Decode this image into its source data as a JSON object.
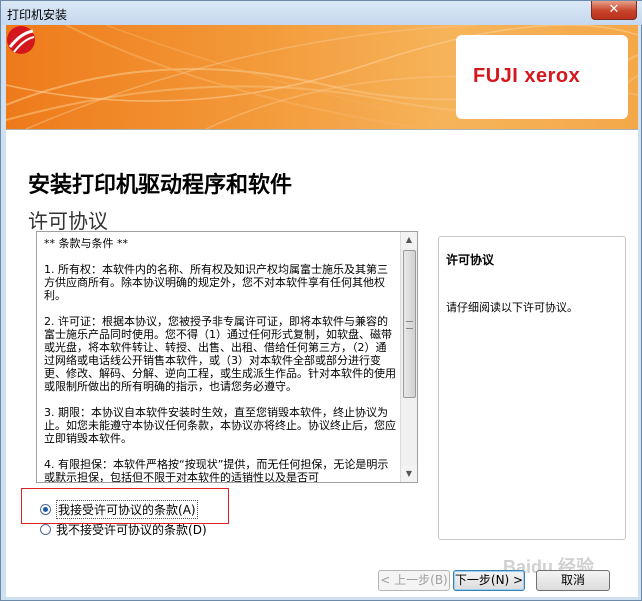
{
  "window": {
    "title": "打印机安装",
    "close_glyph": "✕"
  },
  "banner": {
    "logo_text": "FUJI xerox",
    "logo_color": "#d4161d",
    "accent": "#ee7a1a"
  },
  "heading": {
    "main": "安装打印机驱动程序和软件",
    "sub": "许可协议"
  },
  "license": {
    "text": "** 条款与条件 **\n\n1. 所有权：本软件内的名称、所有权及知识产权均属富士施乐及其第三方供应商所有。除本协议明确的规定外，您不对本软件享有任何其他权利。\n\n2. 许可证：根据本协议，您被授予非专属许可证，即将本软件与兼容的富士施乐产品同时使用。您不得（1）通过任何形式复制，如软盘、磁带或光盘，将本软件转让、转授、出售、出租、借给任何第三方，（2）通过网络或电话线公开销售本软件，或（3）对本软件全部或部分进行变更、修改、解码、分解、逆向工程，或生成派生作品。针对本软件的使用或限制所做出的所有明确的指示，也请您务必遵守。\n\n3. 期限：本协议自本软件安装时生效，直至您销毁本软件，终止协议为止。如您未能遵守本协议任何条款，本协议亦将终止。协议终止后，您应立即销毁本软件。\n\n4. 有限担保：本软件严格按“按现状”提供，而无任何担保，无论是明示或默示担保，包括但不限于对本软件的适销性以及是否可"
  },
  "info_panel": {
    "title": "许可协议",
    "text": "请仔细阅读以下许可协议。"
  },
  "options": {
    "accept": "我接受许可协议的条款",
    "accept_key": "(A)",
    "decline": "我不接受许可协议的条款",
    "decline_key": "(D)",
    "selected": "accept"
  },
  "buttons": {
    "back": "< 上一步(B)",
    "next": "下一步(N) >",
    "cancel": "取消"
  },
  "watermark": "Baidu 经验"
}
